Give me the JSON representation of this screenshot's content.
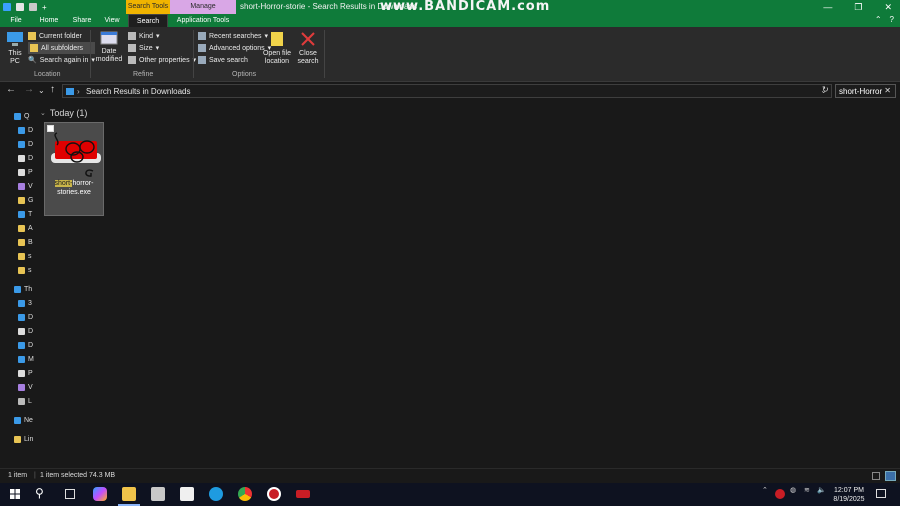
{
  "window": {
    "title": "short-Horror-storie - Search Results in Downloads",
    "watermark": "www.BANDICAM.com",
    "context_tab_search": "Search Tools",
    "context_tab_manage": "Manage"
  },
  "tabs": [
    {
      "label": "File"
    },
    {
      "label": "Home"
    },
    {
      "label": "Share"
    },
    {
      "label": "View"
    },
    {
      "label": "Search"
    },
    {
      "label": "Application Tools"
    }
  ],
  "ribbon": {
    "this_pc": "This PC",
    "current_folder": "Current folder",
    "all_subfolders": "All subfolders",
    "search_again": "Search again in",
    "location_group": "Location",
    "date_modified": "Date modified",
    "kind": "Kind",
    "size": "Size",
    "other_properties": "Other properties",
    "refine_group": "Refine",
    "recent_searches": "Recent searches",
    "advanced_options": "Advanced options",
    "save_search": "Save search",
    "open_file_location": "Open file location",
    "close_search": "Close search",
    "options_group": "Options"
  },
  "address": {
    "path": "Search Results in Downloads",
    "search_value": "short-Horror"
  },
  "group": {
    "label": "Today (1)"
  },
  "file": {
    "name_match": "short-",
    "name_rest1": "horror-",
    "name_rest2": "stories.exe"
  },
  "status": {
    "count": "1 item",
    "selected": "1 item selected  74.3 MB"
  },
  "clock": {
    "time": "12:07 PM",
    "date": "8/19/2025"
  },
  "colors": {
    "titlebar": "#0f7b3a",
    "search_tools": "#f0b400",
    "manage": "#d9a7e6"
  }
}
